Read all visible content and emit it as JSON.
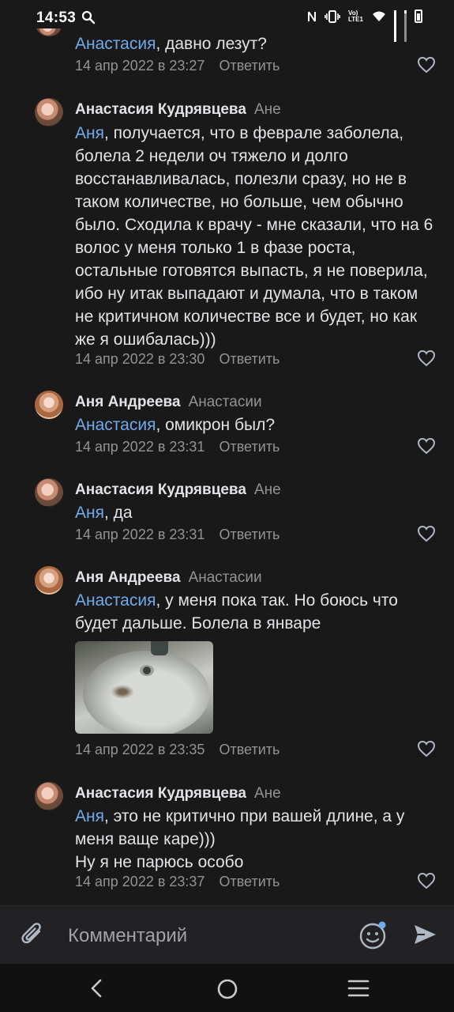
{
  "status_bar": {
    "time": "14:53",
    "icons": [
      "search-icon",
      "nfc-icon",
      "vibrate-icon",
      "volte-icon",
      "wifi-icon",
      "signal-icon",
      "signal-icon",
      "battery-icon"
    ],
    "volte_label": "Vo) LTE1"
  },
  "comments": [
    {
      "author": "",
      "reply_to": "",
      "mention": "Анастасия",
      "text": ", давно лезут?",
      "date": "14 апр 2022 в 23:27",
      "reply_label": "Ответить"
    },
    {
      "author": "Анастасия Кудрявцева",
      "reply_to": "Ане",
      "mention": "Аня",
      "text": ", получается, что в феврале заболела, болела 2 недели оч тяжело и долго восстанавливалась, полезли сразу, но не в таком количестве, но больше, чем обычно было. Сходила к врачу - мне сказали, что на 6 волос у меня только 1 в фазе роста, остальные готовятся выпасть, я не поверила, ибо ну итак выпадают и думала, что в таком не критичном количестве все и будет, но как же я ошибалась)))",
      "date": "14 апр 2022 в 23:30",
      "reply_label": "Ответить"
    },
    {
      "author": "Аня Андреева",
      "reply_to": "Анастасии",
      "mention": "Анастасия",
      "text": ", омикрон был?",
      "date": "14 апр 2022 в 23:31",
      "reply_label": "Ответить"
    },
    {
      "author": "Анастасия Кудрявцева",
      "reply_to": "Ане",
      "mention": "Аня",
      "text": ", да",
      "date": "14 апр 2022 в 23:31",
      "reply_label": "Ответить"
    },
    {
      "author": "Аня Андреева",
      "reply_to": "Анастасии",
      "mention": "Анастасия",
      "text": ", у меня пока так. Но боюсь что будет дальше. Болела в январе",
      "date": "14 апр 2022 в 23:35",
      "reply_label": "Ответить"
    },
    {
      "author": "Анастасия Кудрявцева",
      "reply_to": "Ане",
      "mention": "Аня",
      "text": ", это не критично при вашей длине, а у меня ваще каре)))",
      "text_line2": "Ну я не парюсь особо",
      "date": "14 апр 2022 в 23:37",
      "reply_label": "Ответить"
    }
  ],
  "composer": {
    "placeholder": "Комментарий",
    "icons": [
      "attach-icon",
      "emoji-icon",
      "send-icon"
    ]
  },
  "navigation": {
    "icons": [
      "back-icon",
      "home-icon",
      "recents-icon"
    ]
  },
  "colors": {
    "background": "#19191a",
    "text": "#e1e3e6",
    "secondary": "#939393",
    "accent": "#71aaeb"
  }
}
